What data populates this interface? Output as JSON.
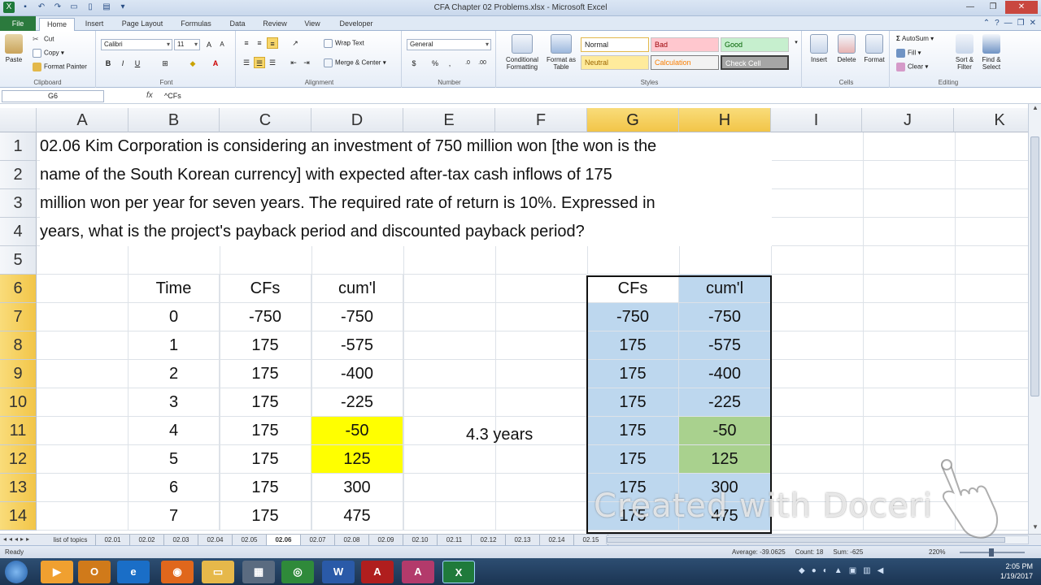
{
  "window": {
    "title": "CFA Chapter 02 Problems.xlsx - Microsoft Excel"
  },
  "ribbon_tabs": [
    "File",
    "Home",
    "Insert",
    "Page Layout",
    "Formulas",
    "Data",
    "Review",
    "View",
    "Developer"
  ],
  "active_tab": "Home",
  "clipboard": {
    "paste": "Paste",
    "cut": "Cut",
    "copy": "Copy",
    "format_painter": "Format Painter",
    "label": "Clipboard"
  },
  "font": {
    "name": "Calibri",
    "size": "11",
    "bold": "B",
    "italic": "I",
    "underline": "U",
    "label": "Font"
  },
  "alignment": {
    "wrap_text": "Wrap Text",
    "merge_center": "Merge & Center",
    "label": "Alignment"
  },
  "number": {
    "format": "General",
    "currency": "$",
    "percent": "%",
    "comma": ",",
    "label": "Number"
  },
  "styles": {
    "conditional_formatting": "Conditional Formatting",
    "format_as_table": "Format as Table",
    "normal": "Normal",
    "bad": "Bad",
    "good": "Good",
    "neutral": "Neutral",
    "calculation": "Calculation",
    "check_cell": "Check Cell",
    "label": "Styles"
  },
  "cells_group": {
    "insert": "Insert",
    "delete": "Delete",
    "format": "Format",
    "label": "Cells"
  },
  "editing": {
    "autosum": "AutoSum",
    "fill": "Fill",
    "clear": "Clear",
    "sort_filter": "Sort & Filter",
    "find_select": "Find & Select",
    "label": "Editing"
  },
  "formula_bar": {
    "name_box": "G6",
    "fx": "fx",
    "formula": "^CFs"
  },
  "columns": [
    "A",
    "B",
    "C",
    "D",
    "E",
    "F",
    "G",
    "H",
    "I",
    "J",
    "K"
  ],
  "rows": [
    "1",
    "2",
    "3",
    "4",
    "5",
    "6",
    "7",
    "8",
    "9",
    "10",
    "11",
    "12",
    "13",
    "14"
  ],
  "problem_text": [
    "02.06 Kim Corporation is considering an investment of 750 million won [the won is the",
    "name of the South Korean currency] with expected after-tax cash inflows of 175",
    "million won per year for seven years. The required rate of return is 10%. Expressed in",
    "years, what is the project's payback period and discounted payback period?"
  ],
  "headers": {
    "time": "Time",
    "cfs": "CFs",
    "cum": "cum'l"
  },
  "table": [
    {
      "time": "0",
      "cf": "-750",
      "cum": "-750"
    },
    {
      "time": "1",
      "cf": "175",
      "cum": "-575"
    },
    {
      "time": "2",
      "cf": "175",
      "cum": "-400"
    },
    {
      "time": "3",
      "cf": "175",
      "cum": "-225"
    },
    {
      "time": "4",
      "cf": "175",
      "cum": "-50"
    },
    {
      "time": "5",
      "cf": "175",
      "cum": "125"
    },
    {
      "time": "6",
      "cf": "175",
      "cum": "300"
    },
    {
      "time": "7",
      "cf": "175",
      "cum": "475"
    }
  ],
  "payback_label": "4.3 years",
  "sheet_tabs": [
    "list of topics",
    "02.01",
    "02.02",
    "02.03",
    "02.04",
    "02.05",
    "02.06",
    "02.07",
    "02.08",
    "02.09",
    "02.10",
    "02.11",
    "02.12",
    "02.13",
    "02.14",
    "02.15"
  ],
  "active_sheet": "02.06",
  "status": {
    "ready": "Ready",
    "average": "Average: -39.0625",
    "count": "Count: 18",
    "sum": "Sum: -625",
    "zoom": "220%"
  },
  "taskbar": {
    "time": "2:05 PM",
    "date": "1/19/2017"
  },
  "watermark": "Created with Doceri",
  "colors": {
    "yellow": "#ffff00",
    "blue": "#bdd7ee",
    "green": "#a9d18e",
    "selected_header": "#f2c548"
  }
}
